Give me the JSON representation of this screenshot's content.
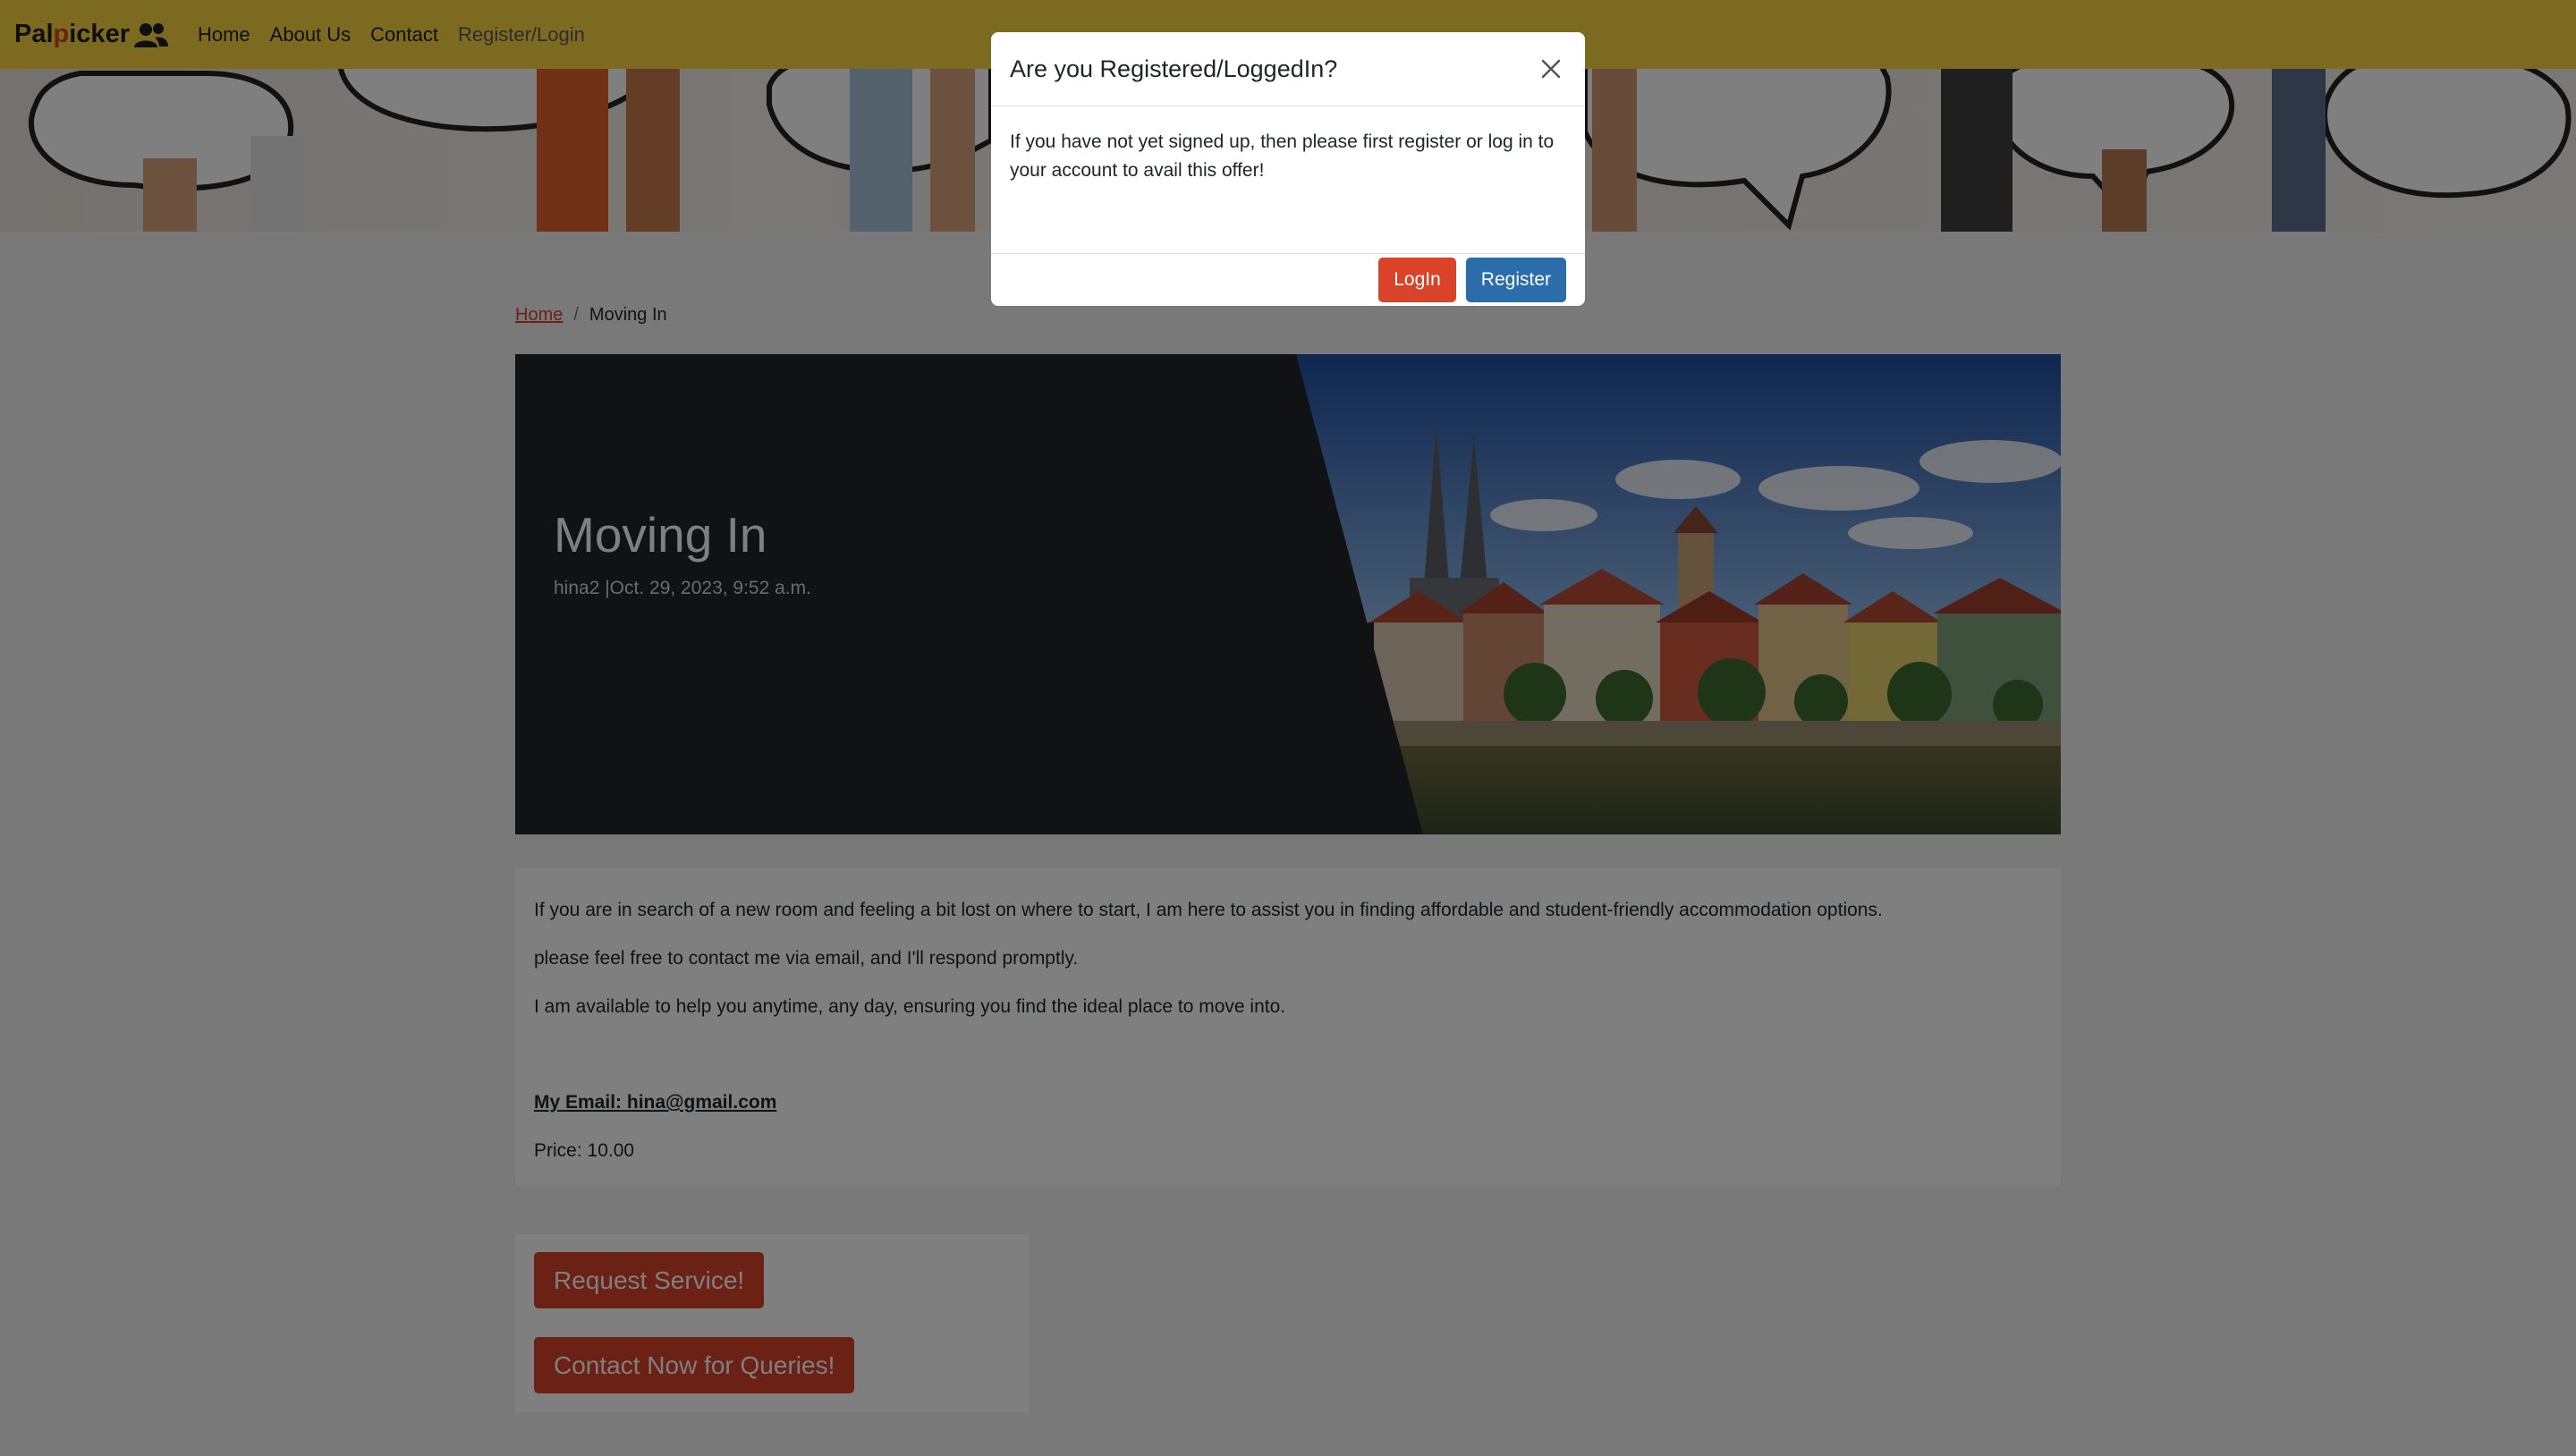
{
  "nav": {
    "brand_pal": "Pal",
    "brand_p": "p",
    "brand_icker": "icker",
    "links": [
      "Home",
      "About Us",
      "Contact",
      "Register/Login"
    ]
  },
  "breadcrumb": {
    "home": "Home",
    "separator": "/",
    "current": "Moving In"
  },
  "post": {
    "title": "Moving In",
    "meta": "hina2 |Oct. 29, 2023, 9:52 a.m.",
    "paragraphs": [
      "If you are in search of a new room and feeling a bit lost on where to start, I am here to assist you in finding affordable and student-friendly accommodation options.",
      "please feel free to contact me via email, and I'll respond promptly.",
      "I am available to help you anytime, any day, ensuring you find the ideal place to move into."
    ],
    "email": "My Email: hina@gmail.com",
    "price": "Price: 10.00"
  },
  "actions": {
    "request": "Request Service!",
    "contact": "Contact Now for Queries!"
  },
  "modal": {
    "title": "Are you Registered/LoggedIn?",
    "body": "If you have not yet signed up, then please first register or log in to your account to avail this offer!",
    "login": "LogIn",
    "register": "Register"
  },
  "colors": {
    "navbar": "#f9d442",
    "accent": "#d9432a",
    "register_button": "#2b6cab",
    "overlay": "rgba(0,0,0,0.5)"
  },
  "icons": {
    "brand": "users-icon",
    "close": "close-icon"
  }
}
